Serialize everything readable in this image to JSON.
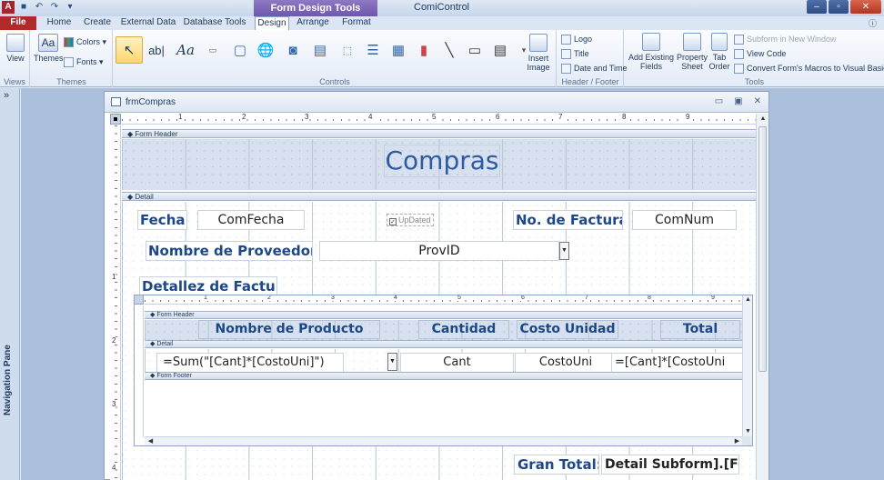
{
  "titlebar": {
    "context_tools": "Form Design Tools",
    "app_title": "ComiControl"
  },
  "tabs": {
    "file": "File",
    "home": "Home",
    "create": "Create",
    "external_data": "External Data",
    "database_tools": "Database Tools",
    "design": "Design",
    "arrange": "Arrange",
    "format": "Format"
  },
  "ribbon": {
    "views": {
      "view": "View",
      "label": "Views"
    },
    "themes": {
      "themes": "Themes",
      "colors": "Colors",
      "fonts": "Fonts",
      "label": "Themes"
    },
    "controls": {
      "label": "Controls",
      "insert_image": "Insert",
      "insert_image2": "Image"
    },
    "header_footer": {
      "logo": "Logo",
      "title": "Title",
      "date_time": "Date and Time",
      "label": "Header / Footer"
    },
    "tools": {
      "add_fields": "Add Existing",
      "add_fields2": "Fields",
      "property_sheet": "Property",
      "property_sheet2": "Sheet",
      "tab_order": "Tab",
      "tab_order2": "Order",
      "subform_new_window": "Subform in New Window",
      "view_code": "View Code",
      "convert_macros": "Convert Form's Macros to Visual Basic",
      "label": "Tools"
    }
  },
  "navpane": {
    "label": "Navigation Pane",
    "chevron": "»"
  },
  "form": {
    "name": "frmCompras",
    "header_section": "Form Header",
    "detail_section": "Detail",
    "title": "Compras",
    "fecha_label": "Fecha:",
    "fecha_field": "ComFecha",
    "updated_label": "UpDated",
    "factura_label": "No. de Factura:",
    "factura_field": "ComNum",
    "proveedor_label": "Nombre de Proveedor :",
    "proveedor_field": "ProvID",
    "detalle_label": "Detallez de Factura",
    "gran_total_label": "Gran Total:",
    "gran_total_field": "Detail Subform].[For"
  },
  "subform": {
    "header_section": "Form Header",
    "detail_section": "Detail",
    "footer_section": "Form Footer",
    "col_producto": "Nombre de Producto",
    "col_cantidad": "Cantidad",
    "col_costo": "Costo Unidad",
    "col_total": "Total",
    "field_sum": "=Sum(\"[Cant]*[CostoUni]\")",
    "field_cant": "Cant",
    "field_costo": "CostoUni",
    "field_total": "=[Cant]*[CostoUni"
  },
  "ruler": {
    "marks": [
      "1",
      "2",
      "3",
      "4",
      "5",
      "6",
      "7",
      "8",
      "9"
    ]
  },
  "colors": {
    "accent": "#1c4887",
    "file_tab": "#b02a2a",
    "context_tab": "#7e68b8"
  }
}
